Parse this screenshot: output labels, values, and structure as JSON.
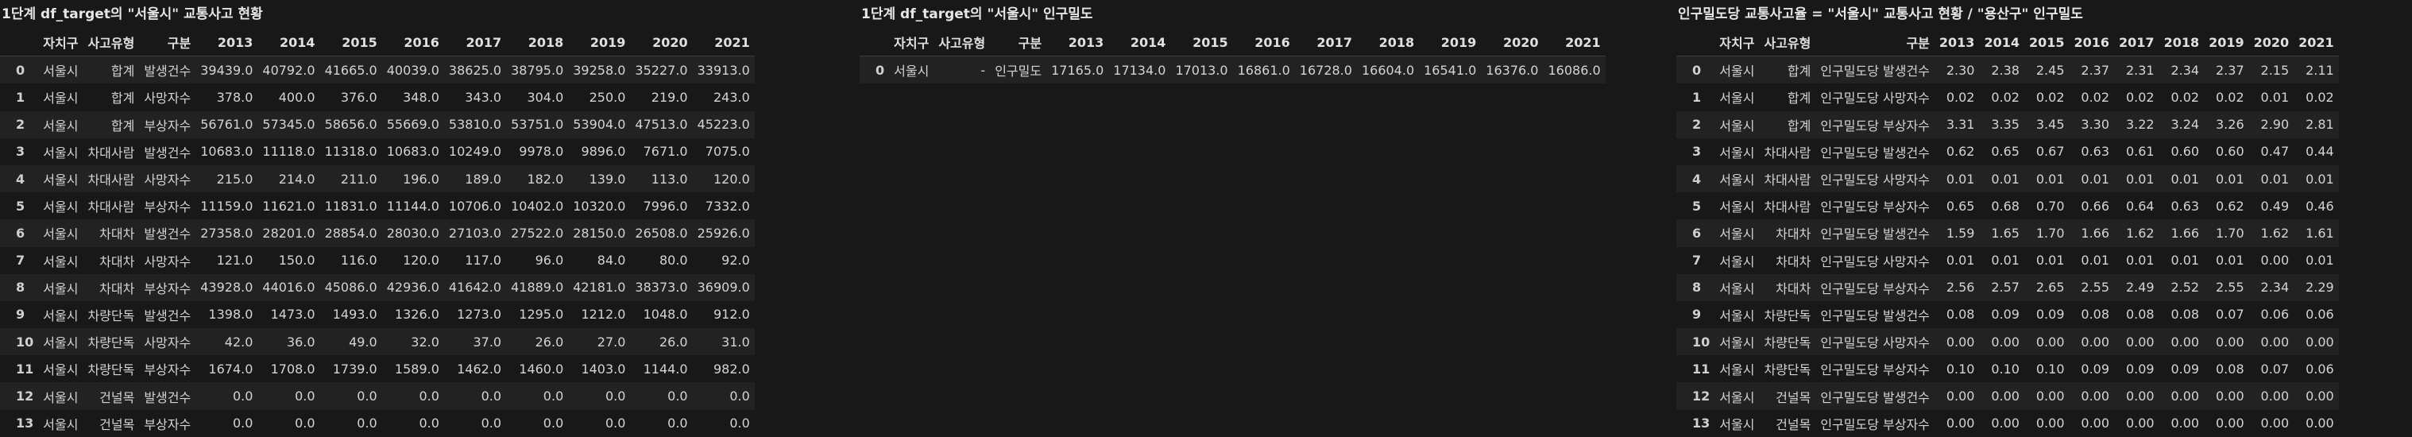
{
  "t1": {
    "title": "1단계 df_target의 \"서울시\" 교통사고 현황",
    "columns": [
      "",
      "자치구",
      "사고유형",
      "구분",
      "2013",
      "2014",
      "2015",
      "2016",
      "2017",
      "2018",
      "2019",
      "2020",
      "2021"
    ],
    "rows": [
      [
        "0",
        "서울시",
        "합계",
        "발생건수",
        "39439.0",
        "40792.0",
        "41665.0",
        "40039.0",
        "38625.0",
        "38795.0",
        "39258.0",
        "35227.0",
        "33913.0"
      ],
      [
        "1",
        "서울시",
        "합계",
        "사망자수",
        "378.0",
        "400.0",
        "376.0",
        "348.0",
        "343.0",
        "304.0",
        "250.0",
        "219.0",
        "243.0"
      ],
      [
        "2",
        "서울시",
        "합계",
        "부상자수",
        "56761.0",
        "57345.0",
        "58656.0",
        "55669.0",
        "53810.0",
        "53751.0",
        "53904.0",
        "47513.0",
        "45223.0"
      ],
      [
        "3",
        "서울시",
        "차대사람",
        "발생건수",
        "10683.0",
        "11118.0",
        "11318.0",
        "10683.0",
        "10249.0",
        "9978.0",
        "9896.0",
        "7671.0",
        "7075.0"
      ],
      [
        "4",
        "서울시",
        "차대사람",
        "사망자수",
        "215.0",
        "214.0",
        "211.0",
        "196.0",
        "189.0",
        "182.0",
        "139.0",
        "113.0",
        "120.0"
      ],
      [
        "5",
        "서울시",
        "차대사람",
        "부상자수",
        "11159.0",
        "11621.0",
        "11831.0",
        "11144.0",
        "10706.0",
        "10402.0",
        "10320.0",
        "7996.0",
        "7332.0"
      ],
      [
        "6",
        "서울시",
        "차대차",
        "발생건수",
        "27358.0",
        "28201.0",
        "28854.0",
        "28030.0",
        "27103.0",
        "27522.0",
        "28150.0",
        "26508.0",
        "25926.0"
      ],
      [
        "7",
        "서울시",
        "차대차",
        "사망자수",
        "121.0",
        "150.0",
        "116.0",
        "120.0",
        "117.0",
        "96.0",
        "84.0",
        "80.0",
        "92.0"
      ],
      [
        "8",
        "서울시",
        "차대차",
        "부상자수",
        "43928.0",
        "44016.0",
        "45086.0",
        "42936.0",
        "41642.0",
        "41889.0",
        "42181.0",
        "38373.0",
        "36909.0"
      ],
      [
        "9",
        "서울시",
        "차량단독",
        "발생건수",
        "1398.0",
        "1473.0",
        "1493.0",
        "1326.0",
        "1273.0",
        "1295.0",
        "1212.0",
        "1048.0",
        "912.0"
      ],
      [
        "10",
        "서울시",
        "차량단독",
        "사망자수",
        "42.0",
        "36.0",
        "49.0",
        "32.0",
        "37.0",
        "26.0",
        "27.0",
        "26.0",
        "31.0"
      ],
      [
        "11",
        "서울시",
        "차량단독",
        "부상자수",
        "1674.0",
        "1708.0",
        "1739.0",
        "1589.0",
        "1462.0",
        "1460.0",
        "1403.0",
        "1144.0",
        "982.0"
      ],
      [
        "12",
        "서울시",
        "건널목",
        "발생건수",
        "0.0",
        "0.0",
        "0.0",
        "0.0",
        "0.0",
        "0.0",
        "0.0",
        "0.0",
        "0.0"
      ],
      [
        "13",
        "서울시",
        "건널목",
        "부상자수",
        "0.0",
        "0.0",
        "0.0",
        "0.0",
        "0.0",
        "0.0",
        "0.0",
        "0.0",
        "0.0"
      ]
    ]
  },
  "t2": {
    "title": "1단계 df_target의 \"서울시\" 인구밀도",
    "columns": [
      "",
      "자치구",
      "사고유형",
      "구분",
      "2013",
      "2014",
      "2015",
      "2016",
      "2017",
      "2018",
      "2019",
      "2020",
      "2021"
    ],
    "rows": [
      [
        "0",
        "서울시",
        "-",
        "인구밀도",
        "17165.0",
        "17134.0",
        "17013.0",
        "16861.0",
        "16728.0",
        "16604.0",
        "16541.0",
        "16376.0",
        "16086.0"
      ]
    ]
  },
  "t3": {
    "title": "인구밀도당 교통사고율 = \"서울시\" 교통사고 현황 / \"용산구\" 인구밀도",
    "columns": [
      "",
      "자치구",
      "사고유형",
      "구분",
      "2013",
      "2014",
      "2015",
      "2016",
      "2017",
      "2018",
      "2019",
      "2020",
      "2021"
    ],
    "rows": [
      [
        "0",
        "서울시",
        "합계",
        "인구밀도당 발생건수",
        "2.30",
        "2.38",
        "2.45",
        "2.37",
        "2.31",
        "2.34",
        "2.37",
        "2.15",
        "2.11"
      ],
      [
        "1",
        "서울시",
        "합계",
        "인구밀도당 사망자수",
        "0.02",
        "0.02",
        "0.02",
        "0.02",
        "0.02",
        "0.02",
        "0.02",
        "0.01",
        "0.02"
      ],
      [
        "2",
        "서울시",
        "합계",
        "인구밀도당 부상자수",
        "3.31",
        "3.35",
        "3.45",
        "3.30",
        "3.22",
        "3.24",
        "3.26",
        "2.90",
        "2.81"
      ],
      [
        "3",
        "서울시",
        "차대사람",
        "인구밀도당 발생건수",
        "0.62",
        "0.65",
        "0.67",
        "0.63",
        "0.61",
        "0.60",
        "0.60",
        "0.47",
        "0.44"
      ],
      [
        "4",
        "서울시",
        "차대사람",
        "인구밀도당 사망자수",
        "0.01",
        "0.01",
        "0.01",
        "0.01",
        "0.01",
        "0.01",
        "0.01",
        "0.01",
        "0.01"
      ],
      [
        "5",
        "서울시",
        "차대사람",
        "인구밀도당 부상자수",
        "0.65",
        "0.68",
        "0.70",
        "0.66",
        "0.64",
        "0.63",
        "0.62",
        "0.49",
        "0.46"
      ],
      [
        "6",
        "서울시",
        "차대차",
        "인구밀도당 발생건수",
        "1.59",
        "1.65",
        "1.70",
        "1.66",
        "1.62",
        "1.66",
        "1.70",
        "1.62",
        "1.61"
      ],
      [
        "7",
        "서울시",
        "차대차",
        "인구밀도당 사망자수",
        "0.01",
        "0.01",
        "0.01",
        "0.01",
        "0.01",
        "0.01",
        "0.01",
        "0.00",
        "0.01"
      ],
      [
        "8",
        "서울시",
        "차대차",
        "인구밀도당 부상자수",
        "2.56",
        "2.57",
        "2.65",
        "2.55",
        "2.49",
        "2.52",
        "2.55",
        "2.34",
        "2.29"
      ],
      [
        "9",
        "서울시",
        "차량단독",
        "인구밀도당 발생건수",
        "0.08",
        "0.09",
        "0.09",
        "0.08",
        "0.08",
        "0.08",
        "0.07",
        "0.06",
        "0.06"
      ],
      [
        "10",
        "서울시",
        "차량단독",
        "인구밀도당 사망자수",
        "0.00",
        "0.00",
        "0.00",
        "0.00",
        "0.00",
        "0.00",
        "0.00",
        "0.00",
        "0.00"
      ],
      [
        "11",
        "서울시",
        "차량단독",
        "인구밀도당 부상자수",
        "0.10",
        "0.10",
        "0.10",
        "0.09",
        "0.09",
        "0.09",
        "0.08",
        "0.07",
        "0.06"
      ],
      [
        "12",
        "서울시",
        "건널목",
        "인구밀도당 발생건수",
        "0.00",
        "0.00",
        "0.00",
        "0.00",
        "0.00",
        "0.00",
        "0.00",
        "0.00",
        "0.00"
      ],
      [
        "13",
        "서울시",
        "건널목",
        "인구밀도당 부상자수",
        "0.00",
        "0.00",
        "0.00",
        "0.00",
        "0.00",
        "0.00",
        "0.00",
        "0.00",
        "0.00"
      ]
    ]
  }
}
